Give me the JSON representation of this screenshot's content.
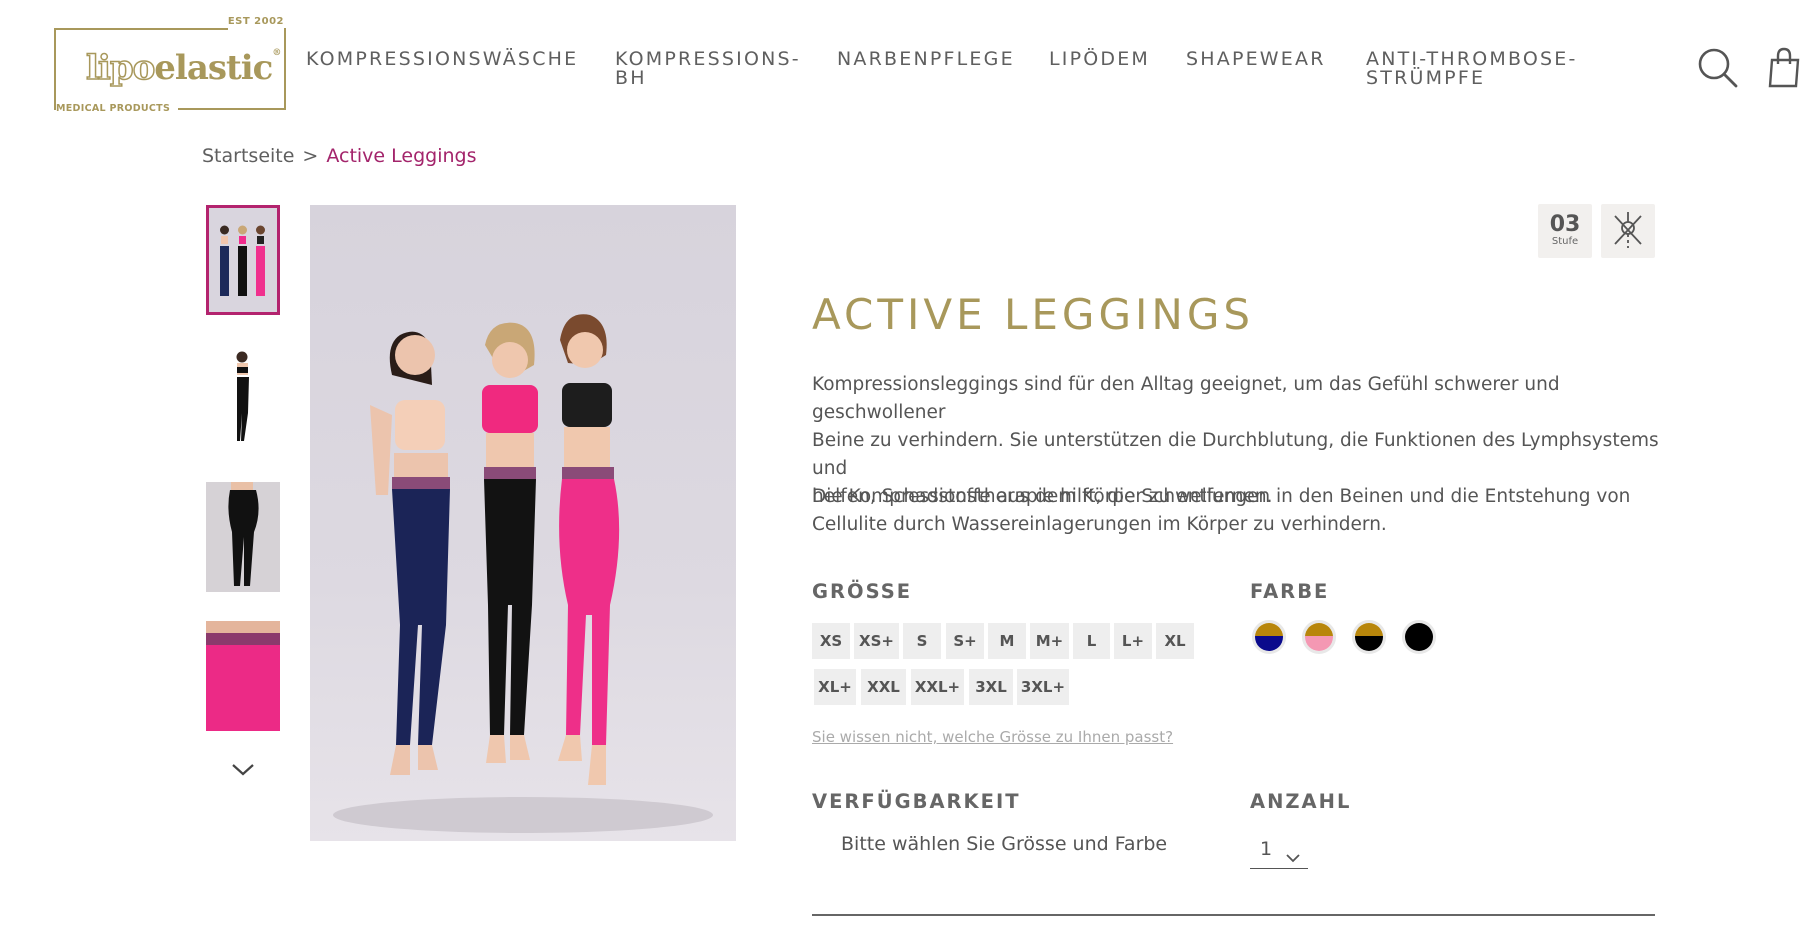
{
  "header": {
    "logo": {
      "est": "EST 2002",
      "word_light": "lipo",
      "word_bold": "elastic",
      "reg": "®",
      "sub": "MEDICAL PRODUCTS"
    },
    "nav": [
      {
        "label": "KOMPRESSIONSWÄSCHE"
      },
      {
        "label": "KOMPRESSIONS-",
        "label2": "BH"
      },
      {
        "label": "NARBENPFLEGE"
      },
      {
        "label": "LIPÖDEM"
      },
      {
        "label": "SHAPEWEAR"
      },
      {
        "label": "ANTI-THROMBOSE-",
        "label2": "STRÜMPFE"
      }
    ],
    "icons": [
      "search-icon",
      "shopping-bag-icon"
    ]
  },
  "breadcrumb": {
    "home": "Startseite",
    "separator": ">",
    "current": "Active Leggings"
  },
  "gallery": {
    "thumbnails": 4,
    "active_index": 0
  },
  "badges": {
    "level_number": "03",
    "level_label": "Stufe",
    "care_icon": "no-tumble-dry-icon"
  },
  "product": {
    "title": "ACTIVE LEGGINGS",
    "desc1_l1": "Kompressionsleggings sind für den Alltag geeignet, um das Gefühl schwerer und geschwollener",
    "desc1_l2": "Beine zu verhindern. Sie unterstützen die Durchblutung, die Funktionen des Lymphsystems und",
    "desc1_l3": "helfen, Schadstoffe aus dem Körper zu entfernen.",
    "desc2_l1": "Die Kompressionstherapie hilft, die Schwellungen in den Beinen und die Entstehung von",
    "desc2_l2": "Cellulite durch Wassereinlagerungen im Körper zu verhindern."
  },
  "size": {
    "heading": "GRÖSSE",
    "options": [
      "XS",
      "XS+",
      "S",
      "S+",
      "M",
      "M+",
      "L",
      "L+",
      "XL",
      "XL+",
      "XXL",
      "XXL+",
      "3XL",
      "3XL+"
    ],
    "help_link": "Sie wissen nicht, welche Grösse zu Ihnen passt?"
  },
  "color": {
    "heading": "FARBE",
    "swatches": [
      {
        "top": "#b8860b",
        "bottom": "#0a0a8c"
      },
      {
        "top": "#b8860b",
        "bottom": "#f498b3"
      },
      {
        "top": "#b8860b",
        "bottom": "#000000"
      },
      {
        "top": "#000000",
        "bottom": "#000000"
      }
    ]
  },
  "availability": {
    "heading": "VERFÜGBARKEIT",
    "text": "Bitte wählen Sie Grösse und Farbe"
  },
  "quantity": {
    "heading": "ANZAHL",
    "value": "1"
  },
  "colors": {
    "accent_gold": "#a8985b",
    "breadcrumb_active": "#a3246b",
    "thumb_border": "#b3236e"
  }
}
